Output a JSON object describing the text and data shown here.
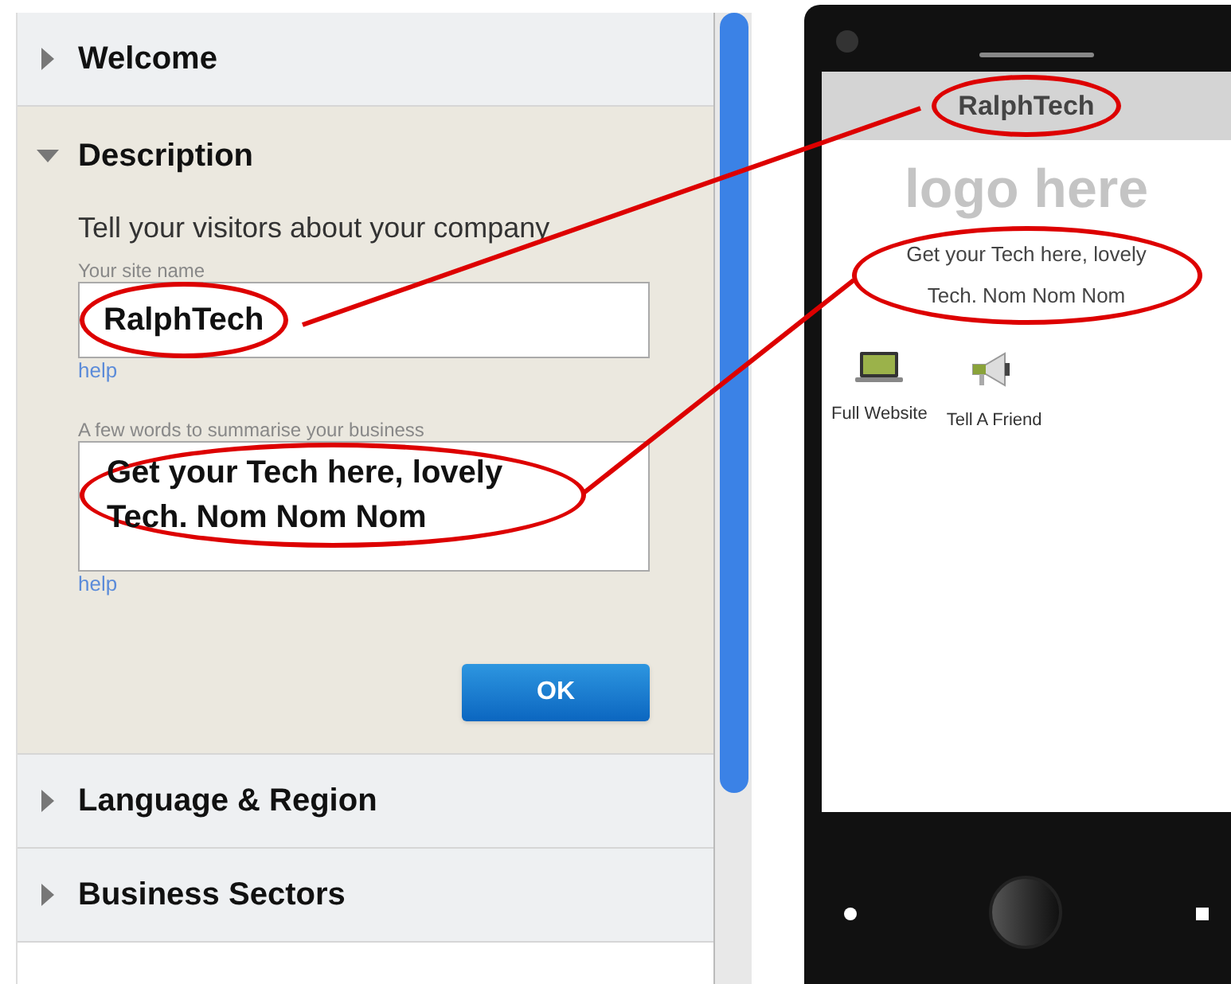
{
  "sections": [
    {
      "title": "Welcome",
      "expanded": false
    },
    {
      "title": "Description",
      "expanded": true,
      "intro": "Tell your visitors about your company",
      "fields": [
        {
          "kind": "input",
          "label": "Your site name",
          "value": "RalphTech",
          "help": "help"
        },
        {
          "kind": "textarea",
          "label": "A few words to summarise your business",
          "value": "Get your Tech here, lovely Tech. Nom Nom Nom",
          "help": "help"
        }
      ],
      "button": "OK"
    },
    {
      "title": "Language & Region",
      "expanded": false
    },
    {
      "title": "Business Sectors",
      "expanded": false
    }
  ],
  "phone": {
    "title": "RalphTech",
    "logo": "logo here",
    "description": "Get your Tech here, lovely Tech. Nom Nom Nom",
    "links": [
      {
        "kind": "laptop",
        "label": "Full Website"
      },
      {
        "kind": "megaphone",
        "label": "Tell A Friend"
      }
    ]
  }
}
